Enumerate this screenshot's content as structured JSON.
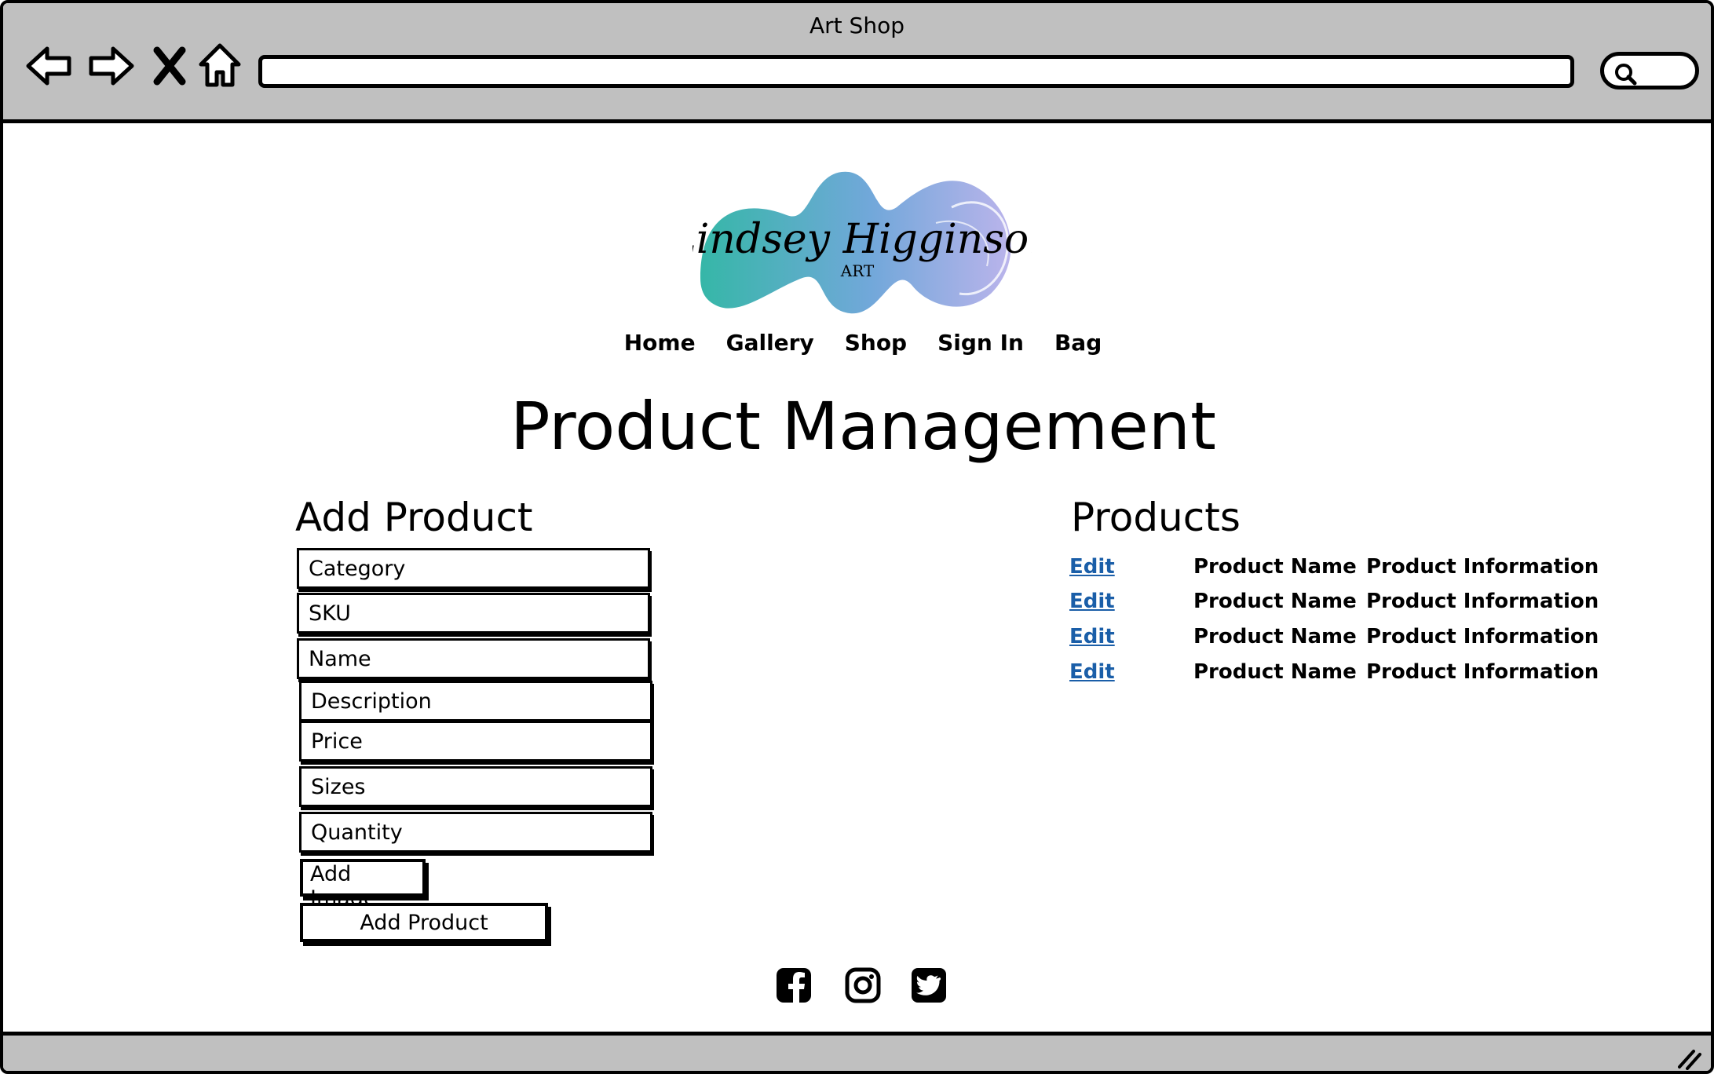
{
  "window": {
    "title": "Art Shop"
  },
  "browser": {
    "back_icon": "arrow-left-icon",
    "forward_icon": "arrow-right-icon",
    "stop_icon": "close-icon",
    "home_icon": "home-icon",
    "url": "",
    "search_icon": "search-icon"
  },
  "logo": {
    "text": "Lindsey Higginson",
    "subtext": "ART"
  },
  "nav": {
    "items": [
      {
        "label": "Home"
      },
      {
        "label": "Gallery"
      },
      {
        "label": "Shop"
      },
      {
        "label": "Sign In"
      },
      {
        "label": "Bag"
      }
    ]
  },
  "page": {
    "title": "Product Management"
  },
  "add_product": {
    "heading": "Add Product",
    "fields": [
      {
        "placeholder": "Category"
      },
      {
        "placeholder": "SKU"
      },
      {
        "placeholder": "Name"
      },
      {
        "placeholder": "Description"
      },
      {
        "placeholder": "Price"
      },
      {
        "placeholder": "Sizes"
      },
      {
        "placeholder": "Quantity"
      }
    ],
    "add_image_label": "Add Image",
    "submit_label": "Add Product"
  },
  "products": {
    "heading": "Products",
    "rows": [
      {
        "edit": "Edit",
        "name": "Product Name",
        "info": "Product Information"
      },
      {
        "edit": "Edit",
        "name": "Product Name",
        "info": "Product Information"
      },
      {
        "edit": "Edit",
        "name": "Product Name",
        "info": "Product Information"
      },
      {
        "edit": "Edit",
        "name": "Product Name",
        "info": "Product Information"
      }
    ]
  },
  "footer": {
    "social_icons": [
      "facebook-icon",
      "instagram-icon",
      "twitter-icon"
    ]
  },
  "colors": {
    "chrome": "#c0c0c0",
    "link": "#1a5ea8",
    "logo_teal": "#2bb3a3",
    "logo_blue": "#6aa3d8",
    "logo_lavender": "#b7b0ea"
  }
}
